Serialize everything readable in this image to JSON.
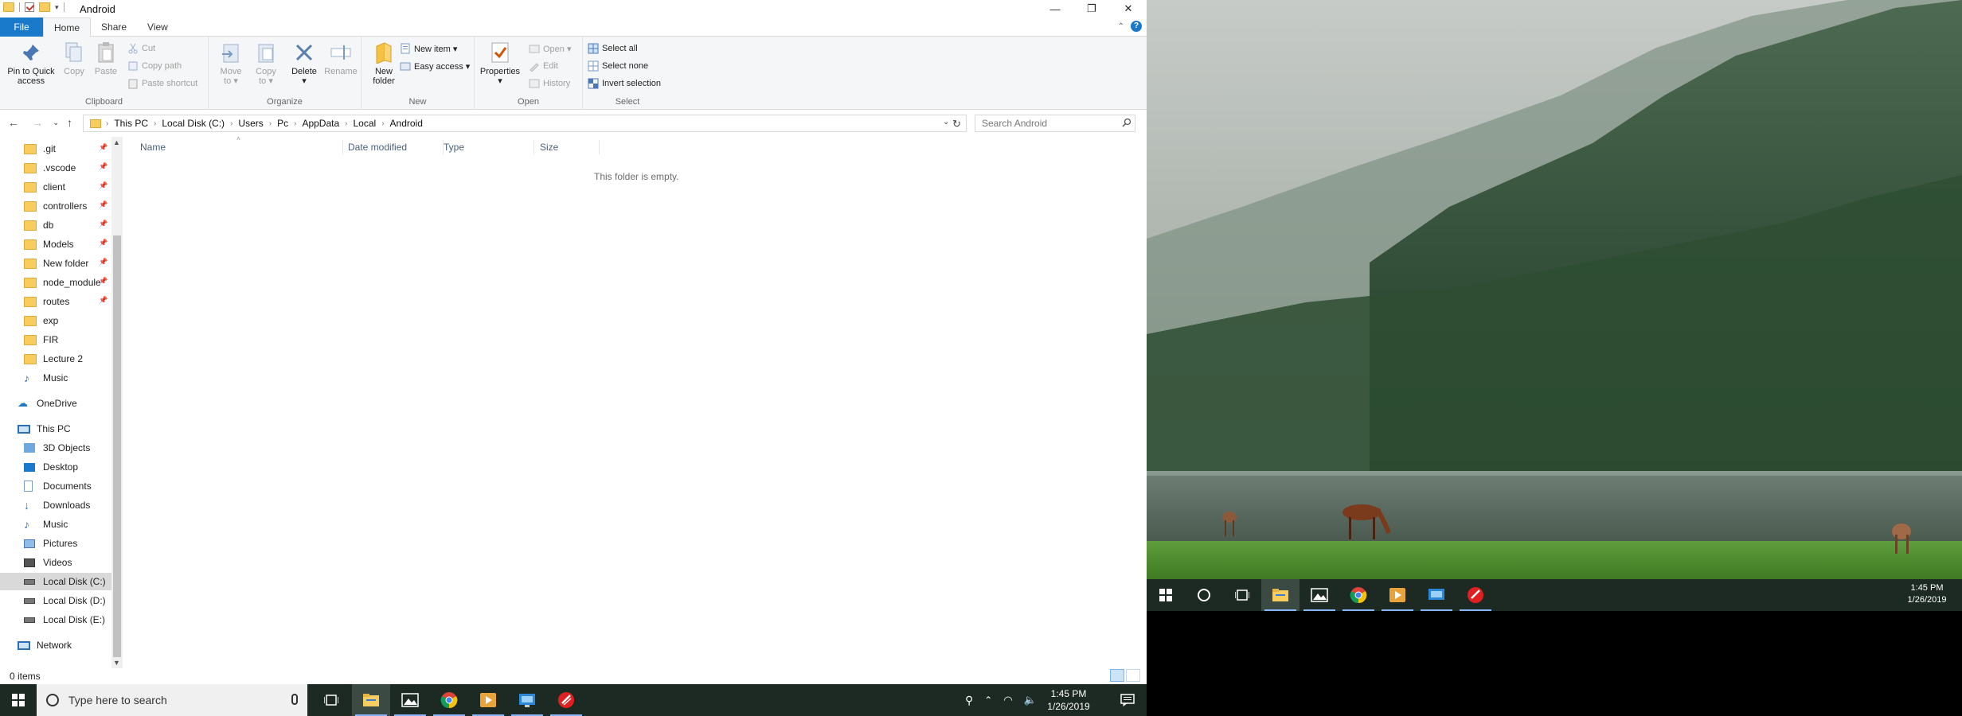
{
  "window": {
    "title": "Android",
    "minimize": "—",
    "maximize": "❐",
    "close": "✕"
  },
  "tabs": [
    "File",
    "Home",
    "Share",
    "View"
  ],
  "ribbon": {
    "clipboard": {
      "label": "Clipboard",
      "pin_line1": "Pin to Quick",
      "pin_line2": "access",
      "copy": "Copy",
      "paste": "Paste",
      "cut": "Cut",
      "copy_path": "Copy path",
      "paste_shortcut": "Paste shortcut"
    },
    "organize": {
      "label": "Organize",
      "move_line1": "Move",
      "move_line2": "to ▾",
      "copy_line1": "Copy",
      "copy_line2": "to ▾",
      "delete_line1": "Delete",
      "delete_line2": "▾",
      "rename": "Rename"
    },
    "new": {
      "label": "New",
      "folder_line1": "New",
      "folder_line2": "folder",
      "new_item": "New item ▾",
      "easy_access": "Easy access ▾"
    },
    "open": {
      "label": "Open",
      "properties_line1": "Properties",
      "properties_line2": "▾",
      "open": "Open ▾",
      "edit": "Edit",
      "history": "History"
    },
    "select": {
      "label": "Select",
      "select_all": "Select all",
      "select_none": "Select none",
      "invert": "Invert selection"
    }
  },
  "address": {
    "crumbs": [
      "This PC",
      "Local Disk (C:)",
      "Users",
      "Pc",
      "AppData",
      "Local",
      "Android"
    ],
    "search_placeholder": "Search Android"
  },
  "nav": {
    "quick": [
      ".git",
      ".vscode",
      "client",
      "controllers",
      "db",
      "Models",
      "New folder",
      "node_modules",
      "routes",
      "exp",
      "FIR",
      "Lecture 2",
      "Music"
    ],
    "onedrive": "OneDrive",
    "this_pc": "This PC",
    "pc_items": [
      "3D Objects",
      "Desktop",
      "Documents",
      "Downloads",
      "Music",
      "Pictures",
      "Videos",
      "Local Disk (C:)",
      "Local Disk (D:)",
      "Local Disk (E:)"
    ],
    "network": "Network"
  },
  "columns": [
    "Name",
    "Date modified",
    "Type",
    "Size"
  ],
  "empty_message": "This folder is empty.",
  "status": {
    "items": "0 items"
  },
  "taskbar": {
    "search_text": "Type here to search",
    "time": "1:45 PM",
    "date": "1/26/2019"
  },
  "desktop_taskbar": {
    "time": "1:45 PM",
    "date": "1/26/2019"
  },
  "colors": {
    "accent": "#1979ca",
    "folder": "#f8cd5f",
    "taskbar": "#1c2a23"
  }
}
